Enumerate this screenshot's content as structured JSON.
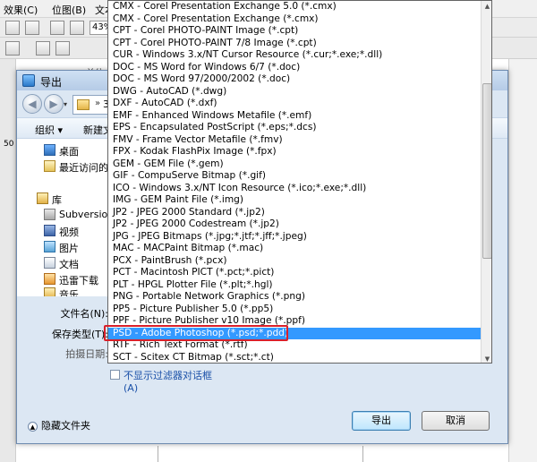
{
  "app": {
    "menu": [
      "效果(C)",
      "位图(B)",
      "文本"
    ],
    "zoom": "43%",
    "unit_label": "单位:",
    "ruler_number": "50"
  },
  "dialog": {
    "title": "导出",
    "back_arrow": "◀",
    "forward_arrow": "▶",
    "address_separator": "»",
    "address_text": "3-",
    "toolbar": {
      "organize": "组织 ▾",
      "new_folder": "新建文"
    },
    "nav_items": [
      {
        "label": "桌面",
        "icon": "desktop-icon"
      },
      {
        "label": "最近访问的位",
        "icon": "recent-places-icon"
      },
      {
        "label": "库",
        "icon": "library-icon"
      },
      {
        "label": "Subversion",
        "icon": "subversion-icon"
      },
      {
        "label": "视频",
        "icon": "video-icon"
      },
      {
        "label": "图片",
        "icon": "pictures-icon"
      },
      {
        "label": "文档",
        "icon": "documents-icon"
      },
      {
        "label": "迅雷下载",
        "icon": "download-icon"
      },
      {
        "label": "音乐",
        "icon": "music-icon"
      }
    ],
    "filename_label": "文件名(N):",
    "filetype_label": "保存类型(T):",
    "shootdate_label": "拍摄日期:",
    "checkbox_label": "不显示过滤器对话框",
    "checkbox_sub": "(A)",
    "hide_folders": "隐藏文件夹",
    "export_button": "导出",
    "cancel_button": "取消"
  },
  "dropdown": {
    "items": [
      "CMX - Corel Presentation Exchange 5.0 (*.cmx)",
      "CMX - Corel Presentation Exchange (*.cmx)",
      "CPT - Corel PHOTO-PAINT Image (*.cpt)",
      "CPT - Corel PHOTO-PAINT 7/8 Image (*.cpt)",
      "CUR - Windows 3.x/NT Cursor Resource (*.cur;*.exe;*.dll)",
      "DOC - MS Word for Windows 6/7 (*.doc)",
      "DOC - MS Word 97/2000/2002 (*.doc)",
      "DWG - AutoCAD (*.dwg)",
      "DXF - AutoCAD (*.dxf)",
      "EMF - Enhanced Windows Metafile (*.emf)",
      "EPS - Encapsulated PostScript (*.eps;*.dcs)",
      "FMV - Frame Vector Metafile (*.fmv)",
      "FPX - Kodak FlashPix Image (*.fpx)",
      "GEM - GEM File (*.gem)",
      "GIF - CompuServe Bitmap (*.gif)",
      "ICO - Windows 3.x/NT Icon Resource (*.ico;*.exe;*.dll)",
      "IMG - GEM Paint File (*.img)",
      "JP2 - JPEG 2000 Standard (*.jp2)",
      "JP2 - JPEG 2000 Codestream (*.jp2)",
      "JPG - JPEG Bitmaps (*.jpg;*.jtf;*.jff;*.jpeg)",
      "MAC - MACPaint Bitmap (*.mac)",
      "PCX - PaintBrush (*.pcx)",
      "PCT - Macintosh PICT (*.pct;*.pict)",
      "PLT - HPGL Plotter File (*.plt;*.hgl)",
      "PNG - Portable Network Graphics (*.png)",
      "PP5 - Picture Publisher 5.0 (*.pp5)",
      "PPF - Picture Publisher v10 Image (*.ppf)",
      "PSD - Adobe Photoshop (*.psd;*.pdd)",
      "RTF - Rich Text Format (*.rtf)",
      "SCT - Scitex CT Bitmap (*.sct;*.ct)"
    ],
    "selected_index": 27,
    "scroll_up": "▲",
    "scroll_down": "▼",
    "selected_color": "#3399ff",
    "highlight_color": "#d9202a"
  }
}
